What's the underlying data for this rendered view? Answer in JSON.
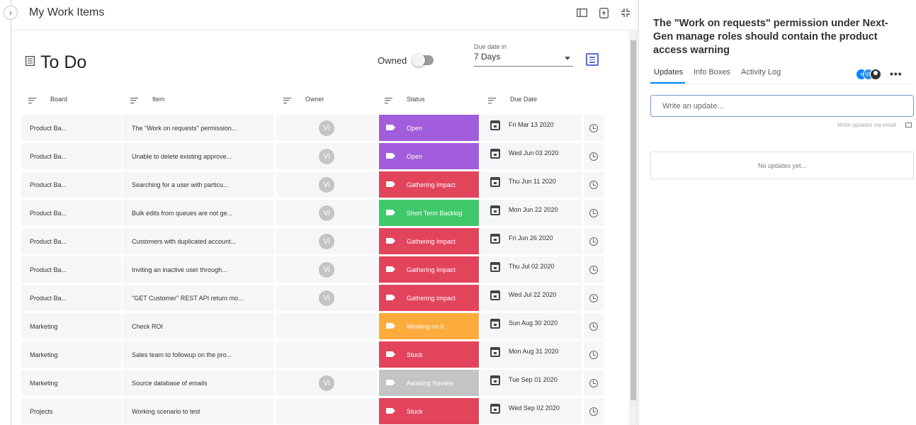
{
  "page": {
    "title": "My Work Items"
  },
  "section": {
    "title": "To Do"
  },
  "filters": {
    "owned_label": "Owned",
    "owned_on": false,
    "due_label": "Due date in",
    "due_value": "7 Days"
  },
  "columns": {
    "board": "Board",
    "item": "Item",
    "owner": "Owner",
    "status": "Status",
    "due": "Due Date"
  },
  "rows": [
    {
      "board": "Product Ba...",
      "item": "The \"Work on requests\" permission...",
      "owner": "Vi",
      "status": "Open",
      "status_color": "#a25ddc",
      "due": "Fri Mar 13 2020"
    },
    {
      "board": "Product Ba...",
      "item": "Unable to delete existing approve...",
      "owner": "Vi",
      "status": "Open",
      "status_color": "#a25ddc",
      "due": "Wed Jun 03 2020"
    },
    {
      "board": "Product Ba...",
      "item": "Searching for a user with particu...",
      "owner": "Vi",
      "status": "Gathering Impact",
      "status_color": "#e2445c",
      "due": "Thu Jun 11 2020"
    },
    {
      "board": "Product Ba...",
      "item": "Bulk edits from queues are not ge...",
      "owner": "Vi",
      "status": "Short Term Backlog",
      "status_color": "#3fc96a",
      "due": "Mon Jun 22 2020"
    },
    {
      "board": "Product Ba...",
      "item": "Customers with duplicated account...",
      "owner": "Vi",
      "status": "Gathering Impact",
      "status_color": "#e2445c",
      "due": "Fri Jun 26 2020"
    },
    {
      "board": "Product Ba...",
      "item": "Inviting an inactive user through...",
      "owner": "Vi",
      "status": "Gathering Impact",
      "status_color": "#e2445c",
      "due": "Thu Jul 02 2020"
    },
    {
      "board": "Product Ba...",
      "item": "\"GET Customer\" REST API return mo...",
      "owner": "Vi",
      "status": "Gathering Impact",
      "status_color": "#e2445c",
      "due": "Wed Jul 22 2020"
    },
    {
      "board": "Marketing",
      "item": "Check ROI",
      "owner": "",
      "status": "Working on it",
      "status_color": "#fdab3d",
      "due": "Sun Aug 30 2020"
    },
    {
      "board": "Marketing",
      "item": "Sales team to followup on the pro...",
      "owner": "",
      "status": "Stuck",
      "status_color": "#e2445c",
      "due": "Mon Aug 31 2020"
    },
    {
      "board": "Marketing",
      "item": "Source database of emails",
      "owner": "Vi",
      "status": "Awaiting Review",
      "status_color": "#c4c4c4",
      "due": "Tue Sep 01 2020"
    },
    {
      "board": "Projects",
      "item": "Working scenario to test",
      "owner": "",
      "status": "Stuck",
      "status_color": "#e2445c",
      "due": "Wed Sep 02 2020"
    }
  ],
  "panel": {
    "title": "The \"Work on requests\" permission under Next-Gen manage roles should contain the product access warning",
    "tabs": [
      "Updates",
      "Info Boxes",
      "Activity Log"
    ],
    "subscriber_initials": "VS",
    "add_symbol": "+",
    "more_symbol": "•••",
    "update_placeholder": "Write an update...",
    "email_note": "Write updates via email",
    "empty_text": "No updates yet..."
  }
}
